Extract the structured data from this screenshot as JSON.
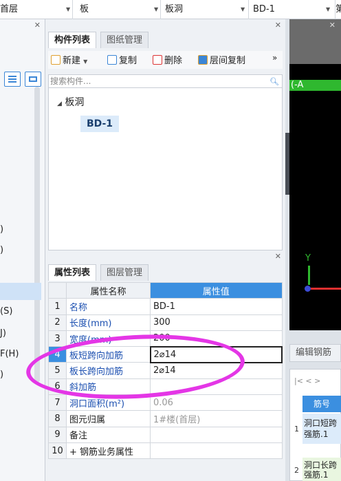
{
  "topbar": {
    "floor": "首层",
    "category": "板",
    "type": "板洞",
    "component": "BD-1",
    "extra": "第"
  },
  "left_panel": {
    "items": [
      ")",
      ")",
      "(S)",
      "J)",
      "F(H)",
      ")"
    ]
  },
  "component_panel": {
    "tabs": [
      "构件列表",
      "图纸管理"
    ],
    "toolbar": {
      "new": "新建",
      "copy": "复制",
      "delete": "删除",
      "floor_copy": "层间复制",
      "more": "»"
    },
    "search_placeholder": "搜索构件...",
    "tree": {
      "node": "板洞",
      "leaf": "BD-1"
    }
  },
  "property_panel": {
    "tabs": [
      "属性列表",
      "图层管理"
    ],
    "columns": [
      "属性名称",
      "属性值"
    ],
    "rows": [
      {
        "num": "1",
        "name": "名称",
        "value": "BD-1"
      },
      {
        "num": "2",
        "name": "长度(mm)",
        "value": "300"
      },
      {
        "num": "3",
        "name": "宽度(mm)",
        "value": "200"
      },
      {
        "num": "4",
        "name": "板短跨向加筋",
        "value": "2⌀14"
      },
      {
        "num": "5",
        "name": "板长跨向加筋",
        "value": "2⌀14"
      },
      {
        "num": "6",
        "name": "斜加筋",
        "value": ""
      },
      {
        "num": "7",
        "name": "洞口面积(m²)",
        "value": "0.06"
      },
      {
        "num": "8",
        "name": "图元归属",
        "value": "1#楼(首层)"
      },
      {
        "num": "9",
        "name": "备注",
        "value": ""
      },
      {
        "num": "10",
        "name": "+ 钢筋业务属性",
        "value": ""
      }
    ]
  },
  "right_panel": {
    "axis_label": "(-A",
    "y_label": "Y",
    "edit_tab": "编辑钢筋",
    "nav": "|<  <  >",
    "grid_header": "筋号",
    "row1_num": "1",
    "row1_text": "洞口短跨强筋.1",
    "row2_num": "2",
    "row2_text": "洞口长跨强筋.1"
  }
}
